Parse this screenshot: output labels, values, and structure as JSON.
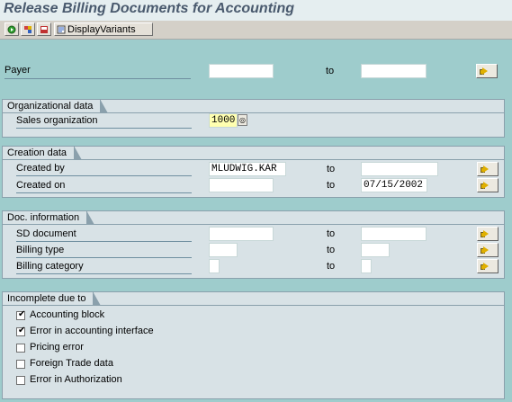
{
  "title": "Release Billing Documents for Accounting",
  "toolbar": {
    "display_variants_label": "DisplayVariants",
    "icons": [
      "execute-icon",
      "get-variant-icon",
      "save-variant-icon",
      "display-variants-icon"
    ]
  },
  "payer": {
    "label": "Payer",
    "from": "",
    "to_label": "to",
    "to": ""
  },
  "org_group": {
    "title": "Organizational data",
    "sales_org": {
      "label": "Sales organization",
      "value": "1000"
    }
  },
  "creation_group": {
    "title": "Creation data",
    "created_by": {
      "label": "Created by",
      "from": "MLUDWIG.KAR",
      "to_label": "to",
      "to": ""
    },
    "created_on": {
      "label": "Created on",
      "from": "",
      "to_label": "to",
      "to": "07/15/2002"
    }
  },
  "doc_group": {
    "title": "Doc. information",
    "sd_document": {
      "label": "SD document",
      "from": "",
      "to_label": "to",
      "to": ""
    },
    "billing_type": {
      "label": "Billing type",
      "from": "",
      "to_label": "to",
      "to": ""
    },
    "billing_category": {
      "label": "Billing category",
      "from": "",
      "to_label": "to",
      "to": ""
    }
  },
  "incomplete_group": {
    "title": "Incomplete due to",
    "items": [
      {
        "label": "Accounting block",
        "checked": true
      },
      {
        "label": "Error in accounting interface",
        "checked": true
      },
      {
        "label": "Pricing error",
        "checked": false
      },
      {
        "label": "Foreign Trade data",
        "checked": false
      },
      {
        "label": "Error in Authorization",
        "checked": false
      }
    ]
  },
  "colors": {
    "background": "#9ECCCC",
    "group_bg": "#D8E2E6",
    "title": "#4A5A6E",
    "arrow": "#E0B000"
  }
}
